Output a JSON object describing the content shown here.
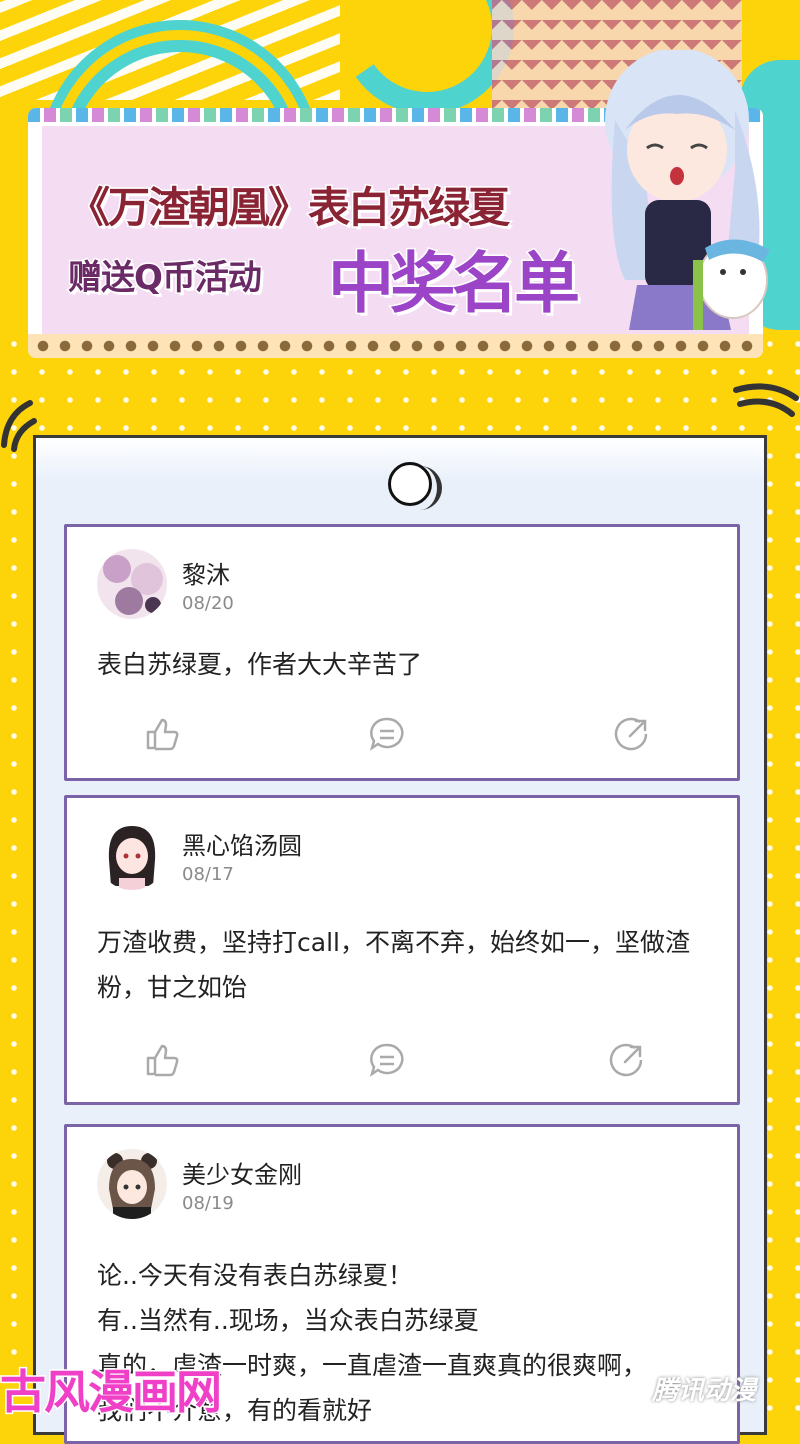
{
  "banner": {
    "title_line1": "《万渣朝凰》表白苏绿夏",
    "title_line2": "赠送Q币活动",
    "title_highlight": "中奖名单"
  },
  "posts": [
    {
      "username": "黎沐",
      "date": "08/20",
      "content": "表白苏绿夏，作者大大辛苦了",
      "icons": [
        "like-icon",
        "comment-icon",
        "share-icon"
      ]
    },
    {
      "username": "黑心馅汤圆",
      "date": "08/17",
      "content": "万渣收费，坚持打call，不离不弃，始终如一，坚做渣粉，甘之如饴",
      "icons": [
        "like-icon",
        "comment-icon",
        "share-icon"
      ]
    },
    {
      "username": "美少女金刚",
      "date": "08/19",
      "content_lines": [
        "论..今天有没有表白苏绿夏！",
        "有..当然有..现场，当众表白苏绿夏",
        "真的，虐渣一时爽，一直虐渣一直爽真的很爽啊，",
        "我们不介意，有的看就好"
      ]
    }
  ],
  "watermarks": {
    "left": "古风漫画网",
    "right": "腾讯动漫"
  },
  "colors": {
    "background": "#fdd30a",
    "accent_teal": "#4fd3cf",
    "card_border": "#7b63a8",
    "highlight_purple": "#9b44c8"
  }
}
